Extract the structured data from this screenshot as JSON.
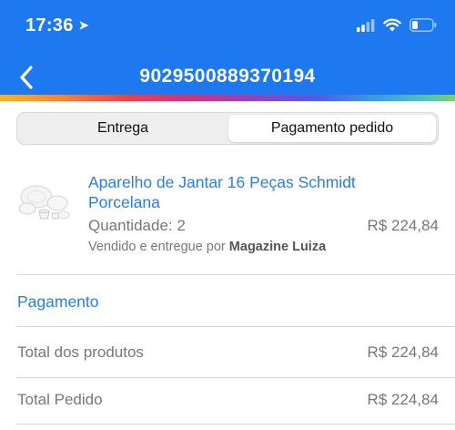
{
  "status_bar": {
    "time": "17:36"
  },
  "nav": {
    "title": "9029500889370194"
  },
  "colors": {
    "header": "#1e78f0",
    "link": "#2a7fe0",
    "muted": "#777777"
  },
  "tabs": [
    {
      "label": "Entrega",
      "selected": false
    },
    {
      "label": "Pagamento pedido",
      "selected": true
    }
  ],
  "product": {
    "name": "Aparelho de Jantar 16 Peças Schmidt Porcelana",
    "quantity_text": "Quantidade: 2",
    "price": "R$ 224,84",
    "seller_prefix": "Vendido e entregue por",
    "seller_name": "Magazine Luiza"
  },
  "payment": {
    "title": "Pagamento",
    "rows": [
      {
        "label": "Total dos produtos",
        "value": "R$ 224,84"
      },
      {
        "label": "Total Pedido",
        "value": "R$ 224,84"
      }
    ]
  },
  "icons": [
    "location-arrow-icon",
    "signal-icon",
    "wifi-icon",
    "battery-icon",
    "back-chevron-icon"
  ]
}
